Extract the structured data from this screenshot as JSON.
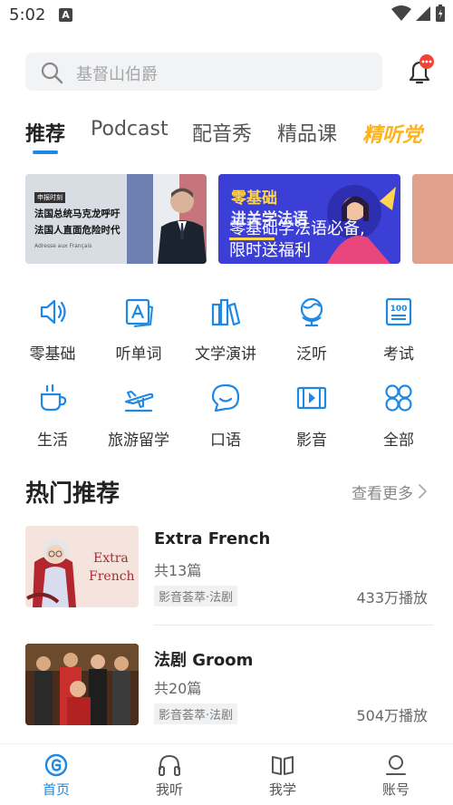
{
  "status_bar": {
    "time": "5:02",
    "notification_letter": "A"
  },
  "search": {
    "placeholder": "基督山伯爵"
  },
  "tabs": [
    {
      "label": "推荐"
    },
    {
      "label": "Podcast"
    },
    {
      "label": "配音秀"
    },
    {
      "label": "精品课"
    }
  ],
  "special_tab": {
    "label": "精听党"
  },
  "banners": {
    "first": {
      "tag": "申报时刻",
      "line1": "法国总统马克龙呼吁",
      "line2": "法国人直面危险时代",
      "subtitle": "Adresse aux Français"
    },
    "second": {
      "title": "零基础",
      "title2": "进关学法语",
      "overlay_line1": "零基础学法语必备,",
      "overlay_line2": "限时送福利"
    }
  },
  "categories": [
    {
      "label": "零基础",
      "icon": "speaker-icon"
    },
    {
      "label": "听单词",
      "icon": "word-card-icon"
    },
    {
      "label": "文学演讲",
      "icon": "books-icon"
    },
    {
      "label": "泛听",
      "icon": "globe-icon"
    },
    {
      "label": "考试",
      "icon": "exam-icon"
    },
    {
      "label": "生活",
      "icon": "coffee-cup-icon"
    },
    {
      "label": "旅游留学",
      "icon": "airplane-icon"
    },
    {
      "label": "口语",
      "icon": "chat-bubble-icon"
    },
    {
      "label": "影音",
      "icon": "film-icon"
    },
    {
      "label": "全部",
      "icon": "grid-icon"
    }
  ],
  "section": {
    "title": "热门推荐",
    "more_label": "查看更多"
  },
  "items": [
    {
      "title": "Extra French",
      "count": "共13篇",
      "tag": "影音荟萃·法剧",
      "plays": "433万播放",
      "thumb_text1": "Extra",
      "thumb_text2": "French"
    },
    {
      "title": "法剧 Groom",
      "count": "共20篇",
      "tag": "影音荟萃·法剧",
      "plays": "504万播放"
    }
  ],
  "bottom_nav": [
    {
      "label": "首页"
    },
    {
      "label": "我听"
    },
    {
      "label": "我学"
    },
    {
      "label": "账号"
    }
  ],
  "colors": {
    "accent": "#1e88e5",
    "special_tab": "#ffb21a",
    "badge": "#f44336"
  }
}
